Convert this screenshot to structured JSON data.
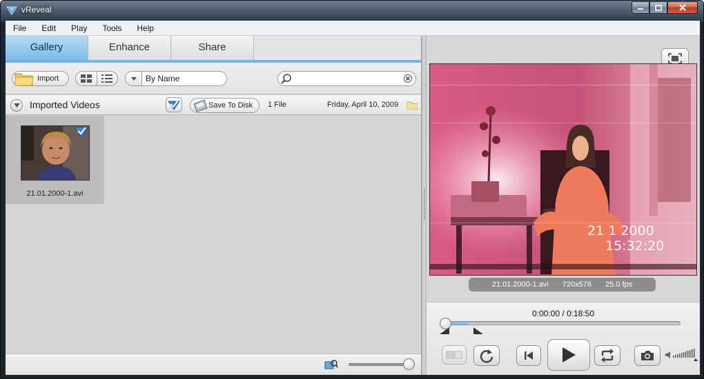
{
  "window": {
    "title": "vReveal"
  },
  "menu": [
    "File",
    "Edit",
    "Play",
    "Tools",
    "Help"
  ],
  "tabs": [
    "Gallery",
    "Enhance",
    "Share"
  ],
  "toolbar": {
    "import_label": "Import",
    "sort_value": "By Name",
    "search_placeholder": ""
  },
  "group": {
    "title": "Imported Videos",
    "save_label": "Save To Disk",
    "file_count": "1 File",
    "date": "Friday, April 10, 2009"
  },
  "gallery_items": [
    {
      "label": "21.01.2000-1.avi",
      "selected": true
    }
  ],
  "preview": {
    "filename": "21.01.2000-1.avi",
    "resolution": "720x576",
    "fps": "25.0 fps",
    "overlay_date": "21 1 2000",
    "overlay_time": "15:32:20"
  },
  "playback": {
    "timecode": "0:00:00 / 0:18:50",
    "position_fraction": 0.0,
    "marked_fraction": 0.11
  },
  "zoom_fraction": 1.0,
  "colors": {
    "accent": "#6fb4e3",
    "active_tab": "#7cbde8"
  },
  "icons": [
    "app-logo-icon",
    "folder-icon",
    "grid-view-icon",
    "list-view-icon",
    "chevron-down-icon",
    "search-icon",
    "clear-icon",
    "checkmark-icon",
    "disk-icon",
    "fullscreen-icon",
    "rotate-icon",
    "previous-icon",
    "play-icon",
    "loop-icon",
    "camera-icon",
    "volume-icon"
  ]
}
